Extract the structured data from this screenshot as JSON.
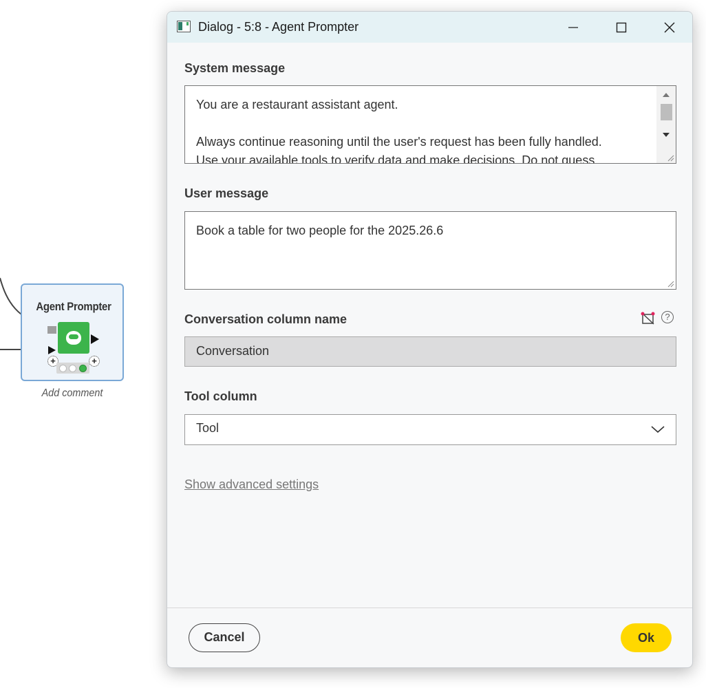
{
  "canvas": {
    "node": {
      "title": "Agent Prompter",
      "add_comment": "Add comment",
      "status": "executed"
    }
  },
  "dialog": {
    "title": "Dialog - 5:8 - Agent Prompter",
    "window_controls": [
      "minimize-icon",
      "maximize-icon",
      "close-icon"
    ],
    "system_message": {
      "label": "System message",
      "lines": [
        "You are a restaurant assistant agent.",
        "",
        "Always continue reasoning until the user's request has been fully handled.",
        "Use your available tools to verify data and make decisions. Do not guess."
      ]
    },
    "user_message": {
      "label": "User message",
      "value": "Book a table for two people for the 2025.26.6"
    },
    "conversation_column": {
      "label": "Conversation column name",
      "value": "Conversation"
    },
    "tool_column": {
      "label": "Tool column",
      "selected": "Tool"
    },
    "advanced_link": "Show advanced settings",
    "buttons": {
      "cancel": "Cancel",
      "ok": "Ok"
    },
    "colors": {
      "accent": "#ffd800",
      "node_green": "#3cb44b",
      "titlebar": "#e5f2f5"
    }
  }
}
